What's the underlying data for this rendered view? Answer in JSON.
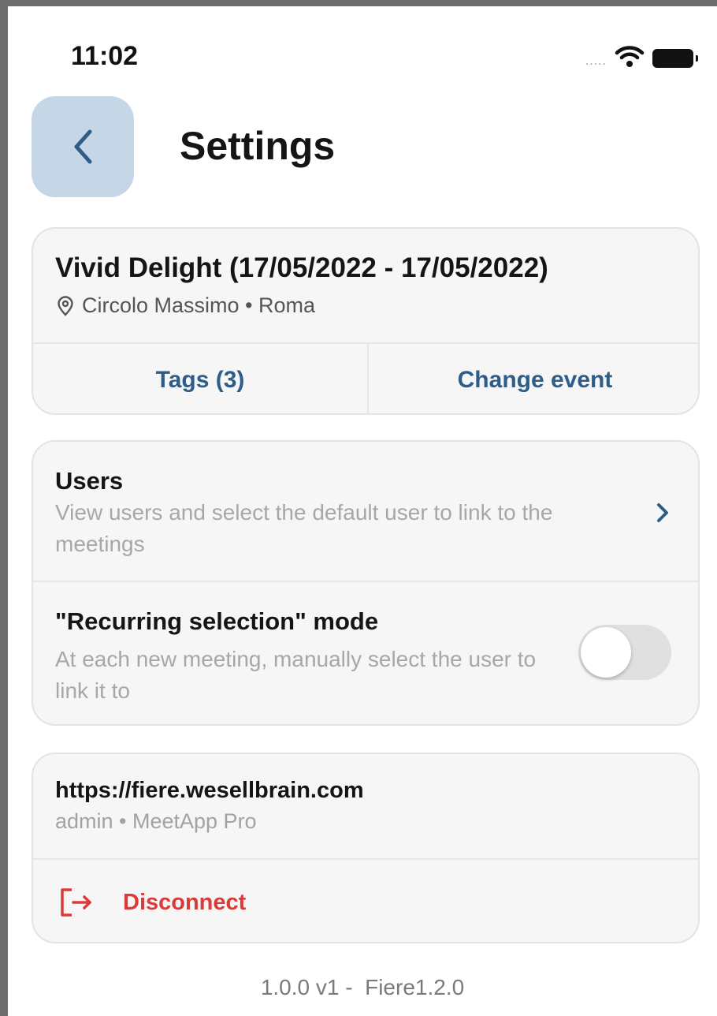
{
  "status_bar": {
    "time": "11:02",
    "signal_dots": "....."
  },
  "header": {
    "title": "Settings",
    "back_icon": "chevron-left-icon"
  },
  "event_card": {
    "title": "Vivid Delight (17/05/2022 - 17/05/2022)",
    "location": "Circolo Massimo • Roma",
    "location_icon": "map-pin-icon",
    "tags_label": "Tags (3)",
    "change_event_label": "Change event"
  },
  "users_card": {
    "users": {
      "title": "Users",
      "description": "View users and select the default user to link to the meetings",
      "icon": "chevron-right-icon"
    },
    "recurring": {
      "title": "\"Recurring selection\" mode",
      "description": "At each new meeting, manually select the user to link it to",
      "enabled": false
    }
  },
  "account_card": {
    "url": "https://fiere.wesellbrain.com",
    "subtitle": "admin • MeetApp Pro",
    "disconnect_label": "Disconnect",
    "disconnect_icon": "logout-icon"
  },
  "footer": {
    "version": "1.0.0 v1 -  Fiere1.2.0"
  },
  "colors": {
    "accent": "#2f5d8a",
    "danger": "#d93a3a",
    "back_button_bg": "#c5d6e6",
    "card_bg": "#f6f6f6"
  }
}
